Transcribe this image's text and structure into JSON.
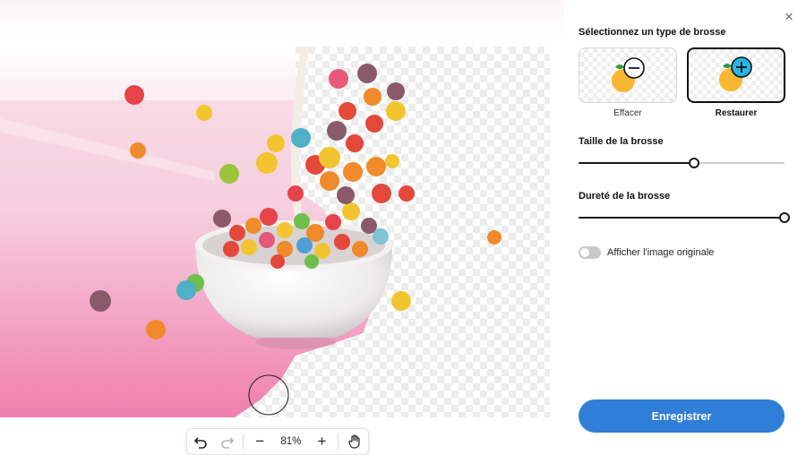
{
  "panel": {
    "close_label": "×",
    "brush_type_title": "Sélectionnez un type de brosse",
    "brush_types": [
      {
        "label": "Effacer",
        "selected": false
      },
      {
        "label": "Restaurer",
        "selected": true
      }
    ],
    "brush_size": {
      "label": "Taille de la brosse",
      "value_fraction": 0.56
    },
    "brush_hardness": {
      "label": "Dureté de la brosse",
      "value_fraction": 1.0
    },
    "show_original": {
      "label": "Afficher l'image originale",
      "on": false
    },
    "save_label": "Enregistrer"
  },
  "toolbar": {
    "undo_icon": "undo-icon",
    "redo_icon": "redo-icon",
    "zoom_out_label": "−",
    "zoom_level": "81%",
    "zoom_in_label": "+",
    "pan_icon": "hand-icon"
  },
  "colors": {
    "accent": "#2f7ed8",
    "selected_border": "#111111",
    "background_pink": "#f3b6cd"
  }
}
